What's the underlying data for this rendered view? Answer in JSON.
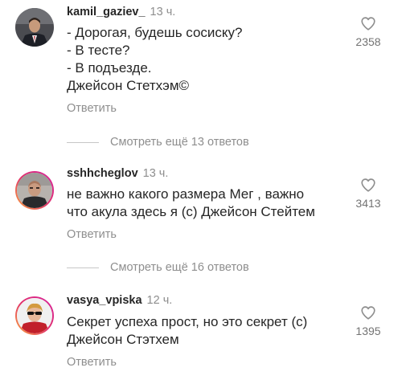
{
  "comments": [
    {
      "username": "kamil_gaziev_",
      "time": "13 ч.",
      "lines": [
        "- Дорогая, будешь сосиску?",
        "- В тесте?",
        "- В подъезде.",
        "Джейсон Стетхэм©"
      ],
      "likes": "2358",
      "reply_label": "Ответить",
      "avatar_icon": "avatar-man-suit",
      "heart_icon": "heart-outline-icon"
    },
    {
      "username": "sshhcheglov",
      "time": "13 ч.",
      "lines": [
        "не важно какого размера  Мег , важно",
        "что акула здесь я (с) Джейсон Стейтем"
      ],
      "likes": "3413",
      "reply_label": "Ответить",
      "avatar_icon": "avatar-man-bald",
      "heart_icon": "heart-outline-icon"
    },
    {
      "username": "vasya_vpiska",
      "time": "12 ч.",
      "lines": [
        "Секрет успеха прост, но это секрет (с)",
        "Джейсон Стэтхем"
      ],
      "likes": "1395",
      "reply_label": "Ответить",
      "avatar_icon": "avatar-man-sunglasses",
      "heart_icon": "heart-outline-icon"
    }
  ],
  "view_more": [
    {
      "label": "Смотреть ещё 13 ответов"
    },
    {
      "label": "Смотреть ещё 16 ответов"
    }
  ],
  "colors": {
    "text": "#262626",
    "secondary": "#8e8e8e",
    "story_ring_start": "#f9a43a",
    "story_ring_end": "#d6249f"
  }
}
